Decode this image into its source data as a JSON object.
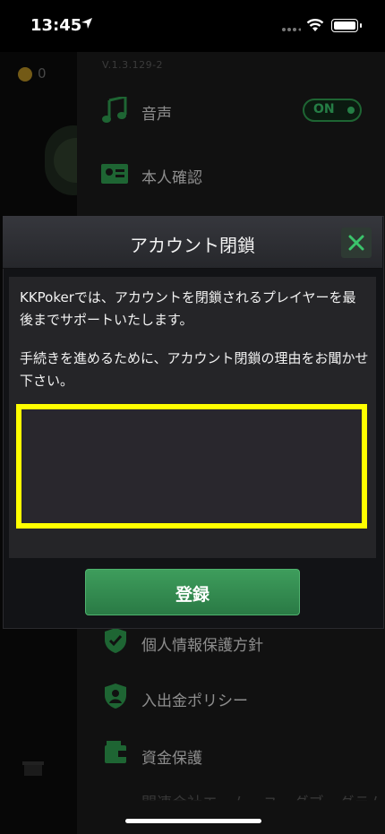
{
  "status_bar": {
    "time": "13:45"
  },
  "background": {
    "coins": "0",
    "version": "V.1.3.129-2",
    "menu_items": [
      {
        "label": "音声",
        "icon": "music-note-icon"
      },
      {
        "label": "本人確認",
        "icon": "id-card-icon"
      },
      {
        "label": "個人情報保護方針",
        "icon": "shield-check-icon"
      },
      {
        "label": "入出金ポリシー",
        "icon": "shield-user-icon"
      },
      {
        "label": "資金保護",
        "icon": "wallet-icon"
      },
      {
        "label": "関連会社エーム・ユーダブーグラム",
        "icon": ""
      }
    ],
    "sound_toggle": "ON"
  },
  "modal": {
    "title": "アカウント閉鎖",
    "message1": "KKPokerでは、アカウントを閉鎖されるプレイヤーを最後までサポートいたします。",
    "message2": "手続きを進めるために、アカウント閉鎖の理由をお聞かせ下さい。",
    "reason_value": "",
    "submit_label": "登録"
  },
  "colors": {
    "accent_green": "#2f9b4f",
    "highlight_yellow": "#ffff00"
  }
}
